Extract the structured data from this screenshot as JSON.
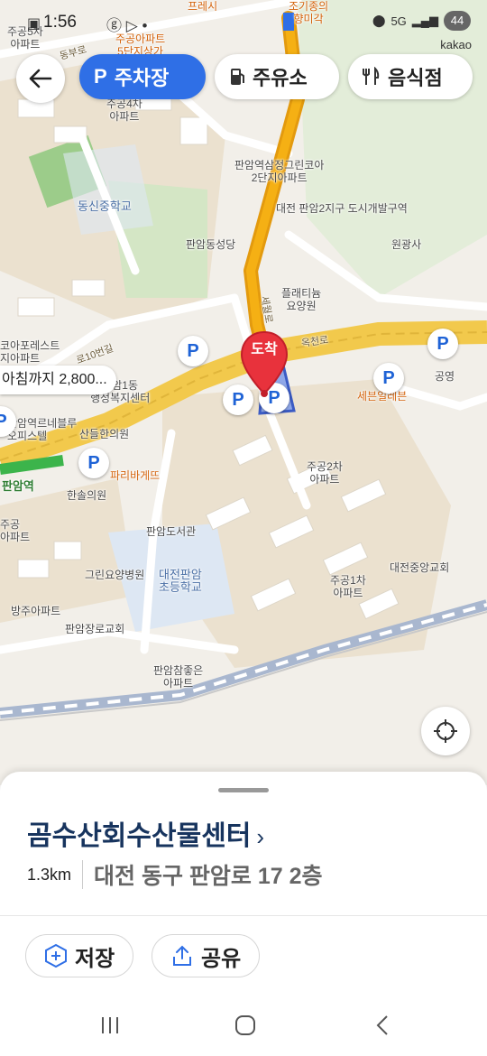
{
  "status_bar": {
    "time": "1:56",
    "network": "5G",
    "battery": "44",
    "app_badge": "kakao"
  },
  "top_bar": {
    "chips": [
      {
        "label": "주차장",
        "icon": "parking-icon",
        "active": true
      },
      {
        "label": "주유소",
        "icon": "fuel-icon",
        "active": false
      },
      {
        "label": "음식점",
        "icon": "restaurant-icon",
        "active": false
      }
    ]
  },
  "map": {
    "labels": {
      "l1": "주공5차\n아파트",
      "l2": "프레시",
      "l3": "주공아파트\n5단지상가",
      "l4": "조기종의\n향미각",
      "l5": "주공4차\n아파트",
      "l6": "판암역삼정그린코아\n2단지아파트",
      "l7": "동신중학교",
      "l8": "대전 판암2지구 도시개발구역",
      "l9": "판암동성당",
      "l10": "원광사",
      "l11": "플래티늄\n요양원",
      "l12": "코아포레스트\n지아파트",
      "l13": "판암1동\n행정복지센터",
      "l14": "공영",
      "l15": "세븐일레븐",
      "l16": "판암역르네블루\n오피스텔",
      "l17": "산들한의원",
      "l18": "판암역",
      "l19": "파리바게뜨",
      "l20": "한솔의원",
      "l21": "주공2차\n아파트",
      "l22": "주공\n아파트",
      "l23": "판암도서관",
      "l24": "대전중앙교회",
      "l25": "그린요양병원",
      "l26": "대전판암\n초등학교",
      "l27": "주공1차\n아파트",
      "l28": "방주아파트",
      "l29": "판암장로교회",
      "l30": "판암참좋은\n아파트",
      "road1": "옥천로",
      "road2": "동부로",
      "road3": "세월로",
      "road4": "로10번길"
    },
    "destination_label": "도착",
    "callout_text": "아침까지 2,800...",
    "parking_letter": "P"
  },
  "sheet": {
    "place_name": "곰수산회수산물센터",
    "distance": "1.3km",
    "address": "대전 동구 판암로 17 2층",
    "actions": [
      {
        "label": "저장",
        "icon": "add-hexagon-icon"
      },
      {
        "label": "공유",
        "icon": "share-icon"
      }
    ]
  }
}
